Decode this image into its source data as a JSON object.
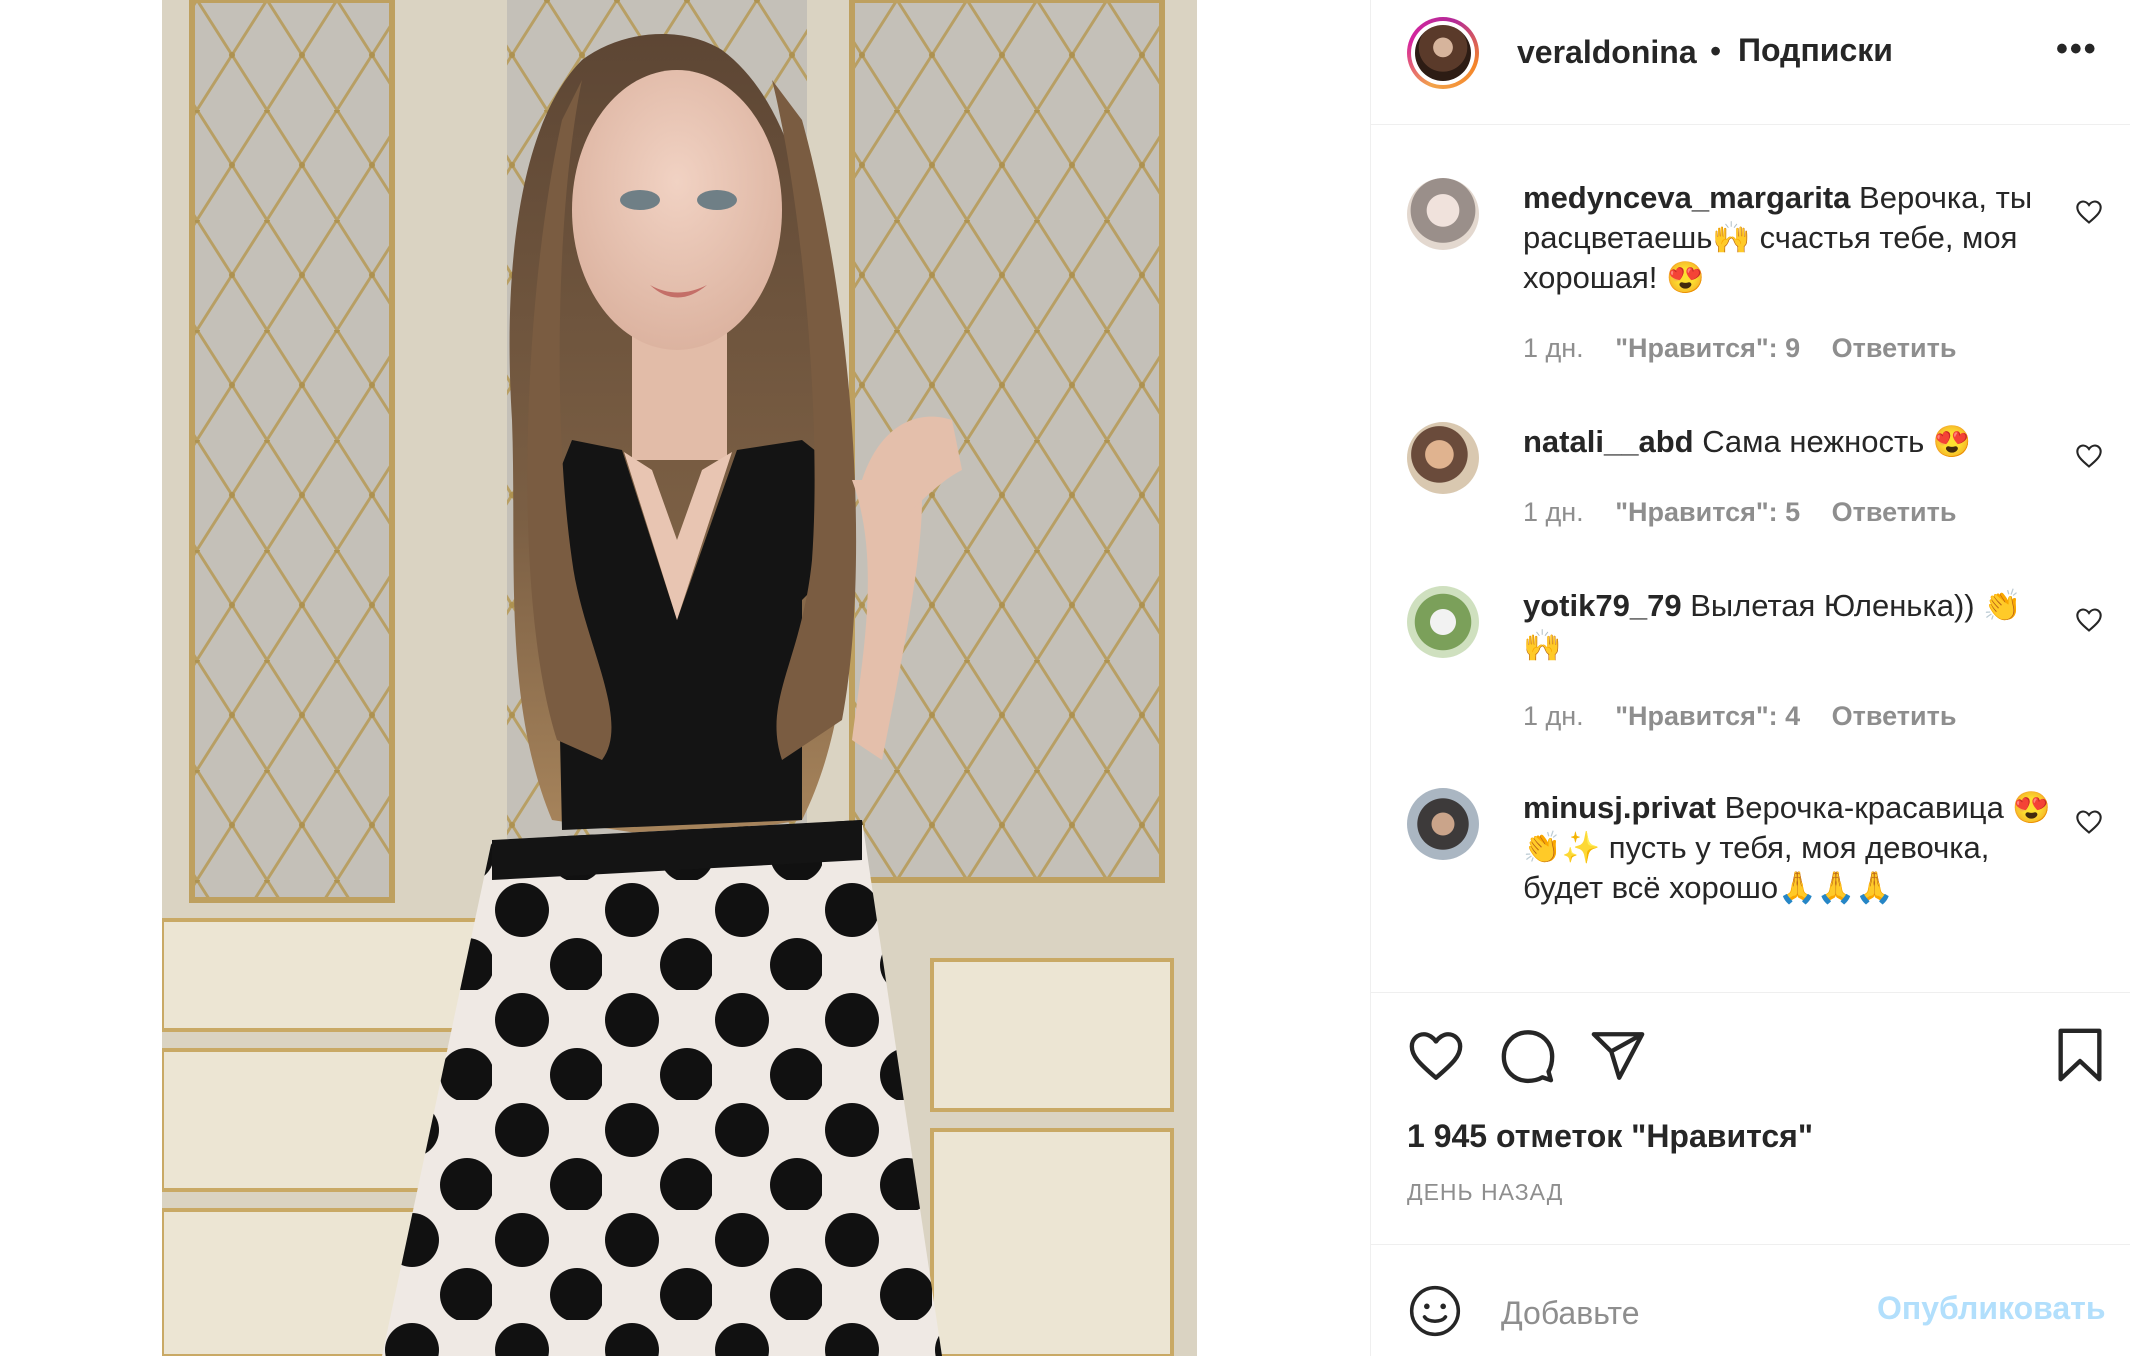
{
  "post_image": {
    "alt": "Фото veraldonina"
  },
  "header": {
    "username": "veraldonina",
    "separator": "•",
    "follow_label": "Подписки",
    "more_label": "•••"
  },
  "comments": [
    {
      "username": "medynceva_margarita",
      "text": "Верочка, ты расцветаешь🙌 счастья тебе, моя хорошая! 😍",
      "time": "1 дн.",
      "likes": "\"Нравится\": 9",
      "reply": "Ответить"
    },
    {
      "username": "natali__abd",
      "text": "Сама нежность 😍",
      "time": "1 дн.",
      "likes": "\"Нравится\": 5",
      "reply": "Ответить"
    },
    {
      "username": "yotik79_79",
      "text": "Вылетая Юленька)) 👏🙌",
      "time": "1 дн.",
      "likes": "\"Нравится\": 4",
      "reply": "Ответить"
    },
    {
      "username": "minusj.privat",
      "text": "Верочка-красавица 😍👏✨ пусть у тебя, моя девочка, будет всё хорошо🙏🙏🙏",
      "time": "",
      "likes": "",
      "reply": ""
    }
  ],
  "actions": {
    "like_icon": "heart-outline",
    "comment_icon": "speech-bubble",
    "share_icon": "paper-plane",
    "save_icon": "bookmark"
  },
  "likes_count": "1 945 отметок \"Нравится\"",
  "date_label": "ДЕНЬ НАЗАД",
  "comment_box": {
    "placeholder": "Добавьте",
    "publish_label": "Опубликовать"
  },
  "colors": {
    "text": "#262626",
    "secondary": "#8e8e8e",
    "divider": "#efefef",
    "publish_disabled": "#b2dffc"
  }
}
